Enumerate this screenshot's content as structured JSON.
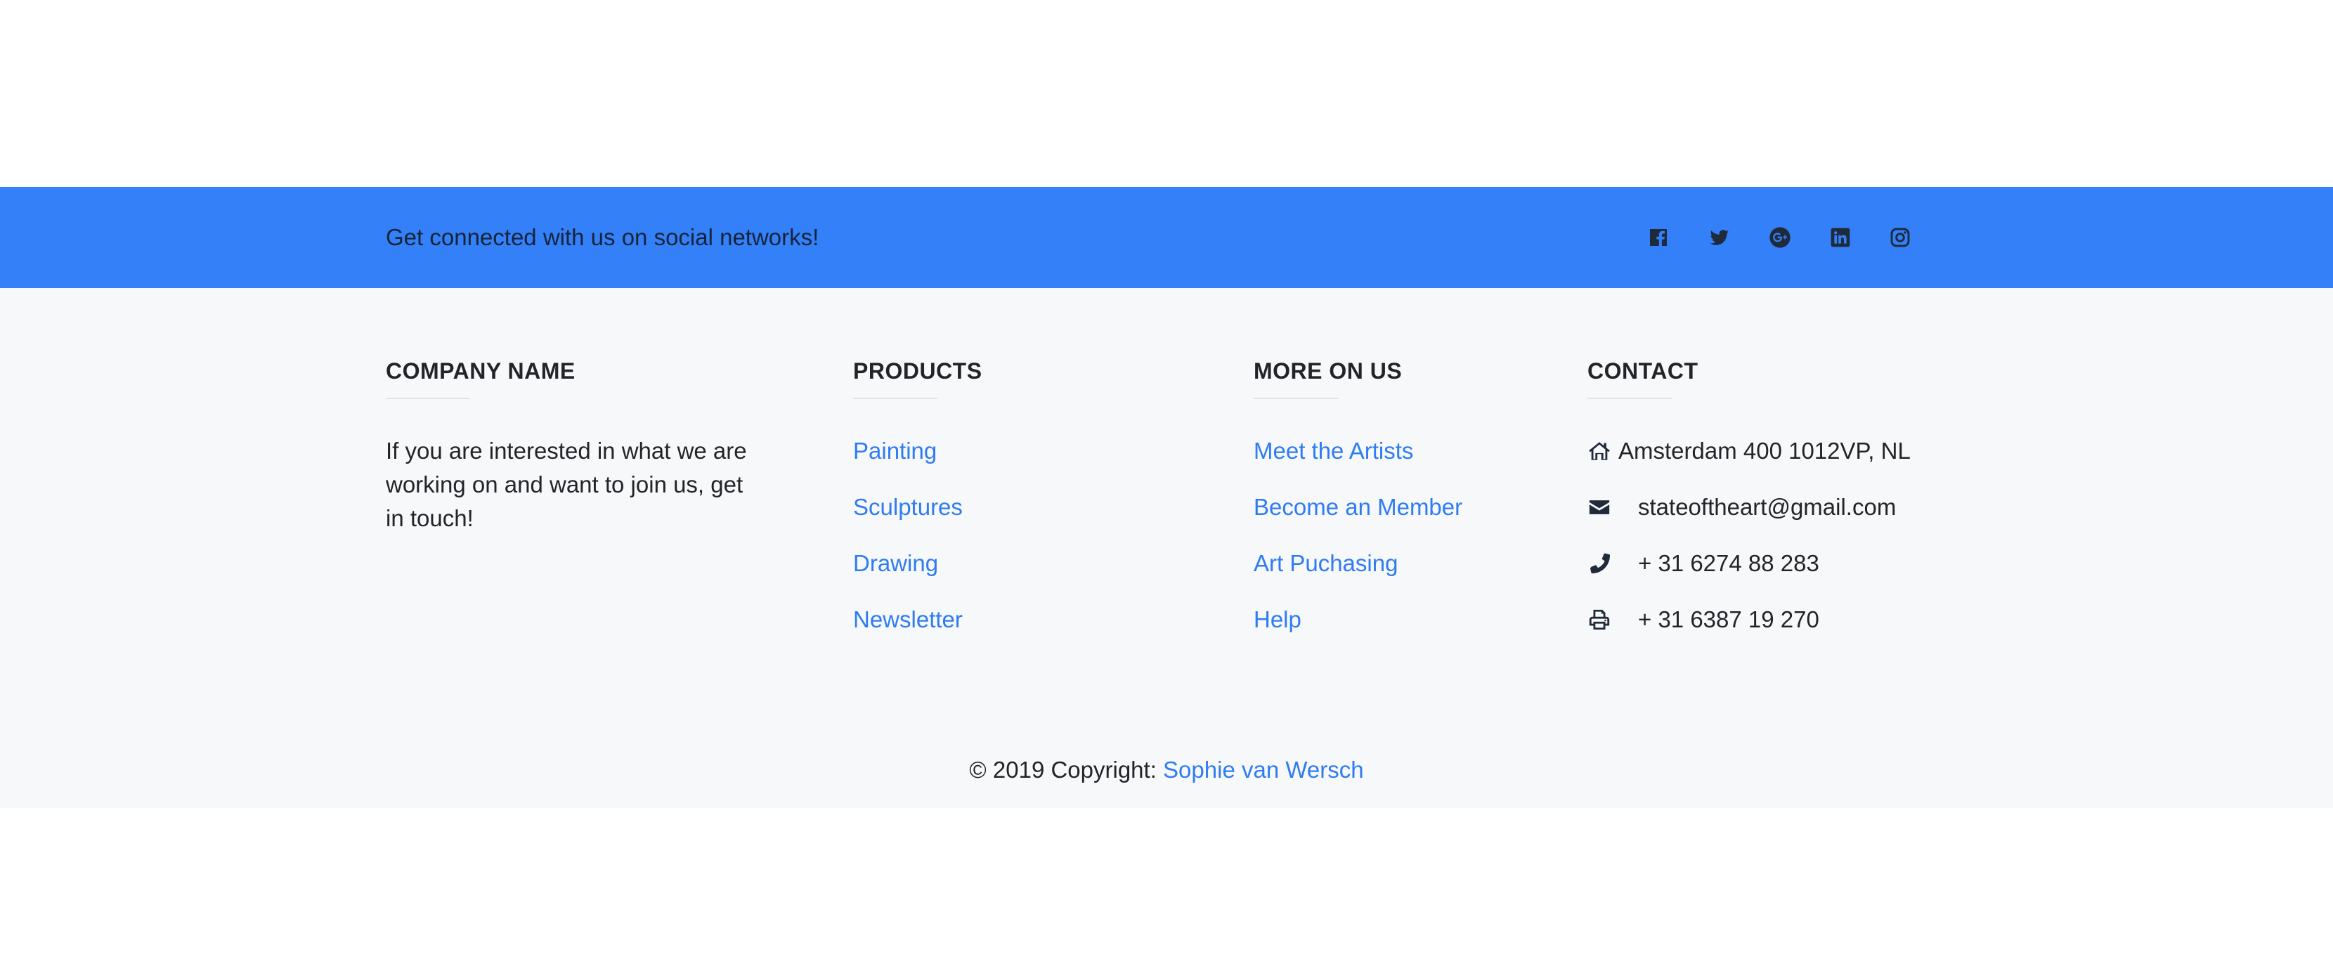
{
  "social": {
    "text": "Get connected with us on social networks!",
    "icons": [
      "facebook-icon",
      "twitter-icon",
      "google-plus-icon",
      "linkedin-icon",
      "instagram-icon"
    ],
    "bar_color": "#3380f8"
  },
  "company": {
    "heading": "COMPANY NAME",
    "text": "If you are interested in what we are working on and want to join us, get in touch!"
  },
  "products": {
    "heading": "PRODUCTS",
    "links": [
      "Painting",
      "Sculptures",
      "Drawing",
      "Newsletter"
    ]
  },
  "more": {
    "heading": "MORE ON US",
    "links": [
      "Meet the Artists",
      "Become an Member",
      "Art Puchasing",
      "Help"
    ]
  },
  "contact": {
    "heading": "CONTACT",
    "address": "Amsterdam 400 1012VP, NL",
    "email": "stateoftheart@gmail.com",
    "phone": "+ 31 6274 88 283",
    "fax": "+ 31 6387 19 270",
    "icons": [
      "home-icon",
      "envelope-icon",
      "phone-icon",
      "print-icon"
    ]
  },
  "copyright": {
    "text": "© 2019 Copyright:",
    "link": "Sophie van Wersch"
  },
  "colors": {
    "link": "#2f7cf2",
    "footer_bg": "#f7f8f9"
  }
}
